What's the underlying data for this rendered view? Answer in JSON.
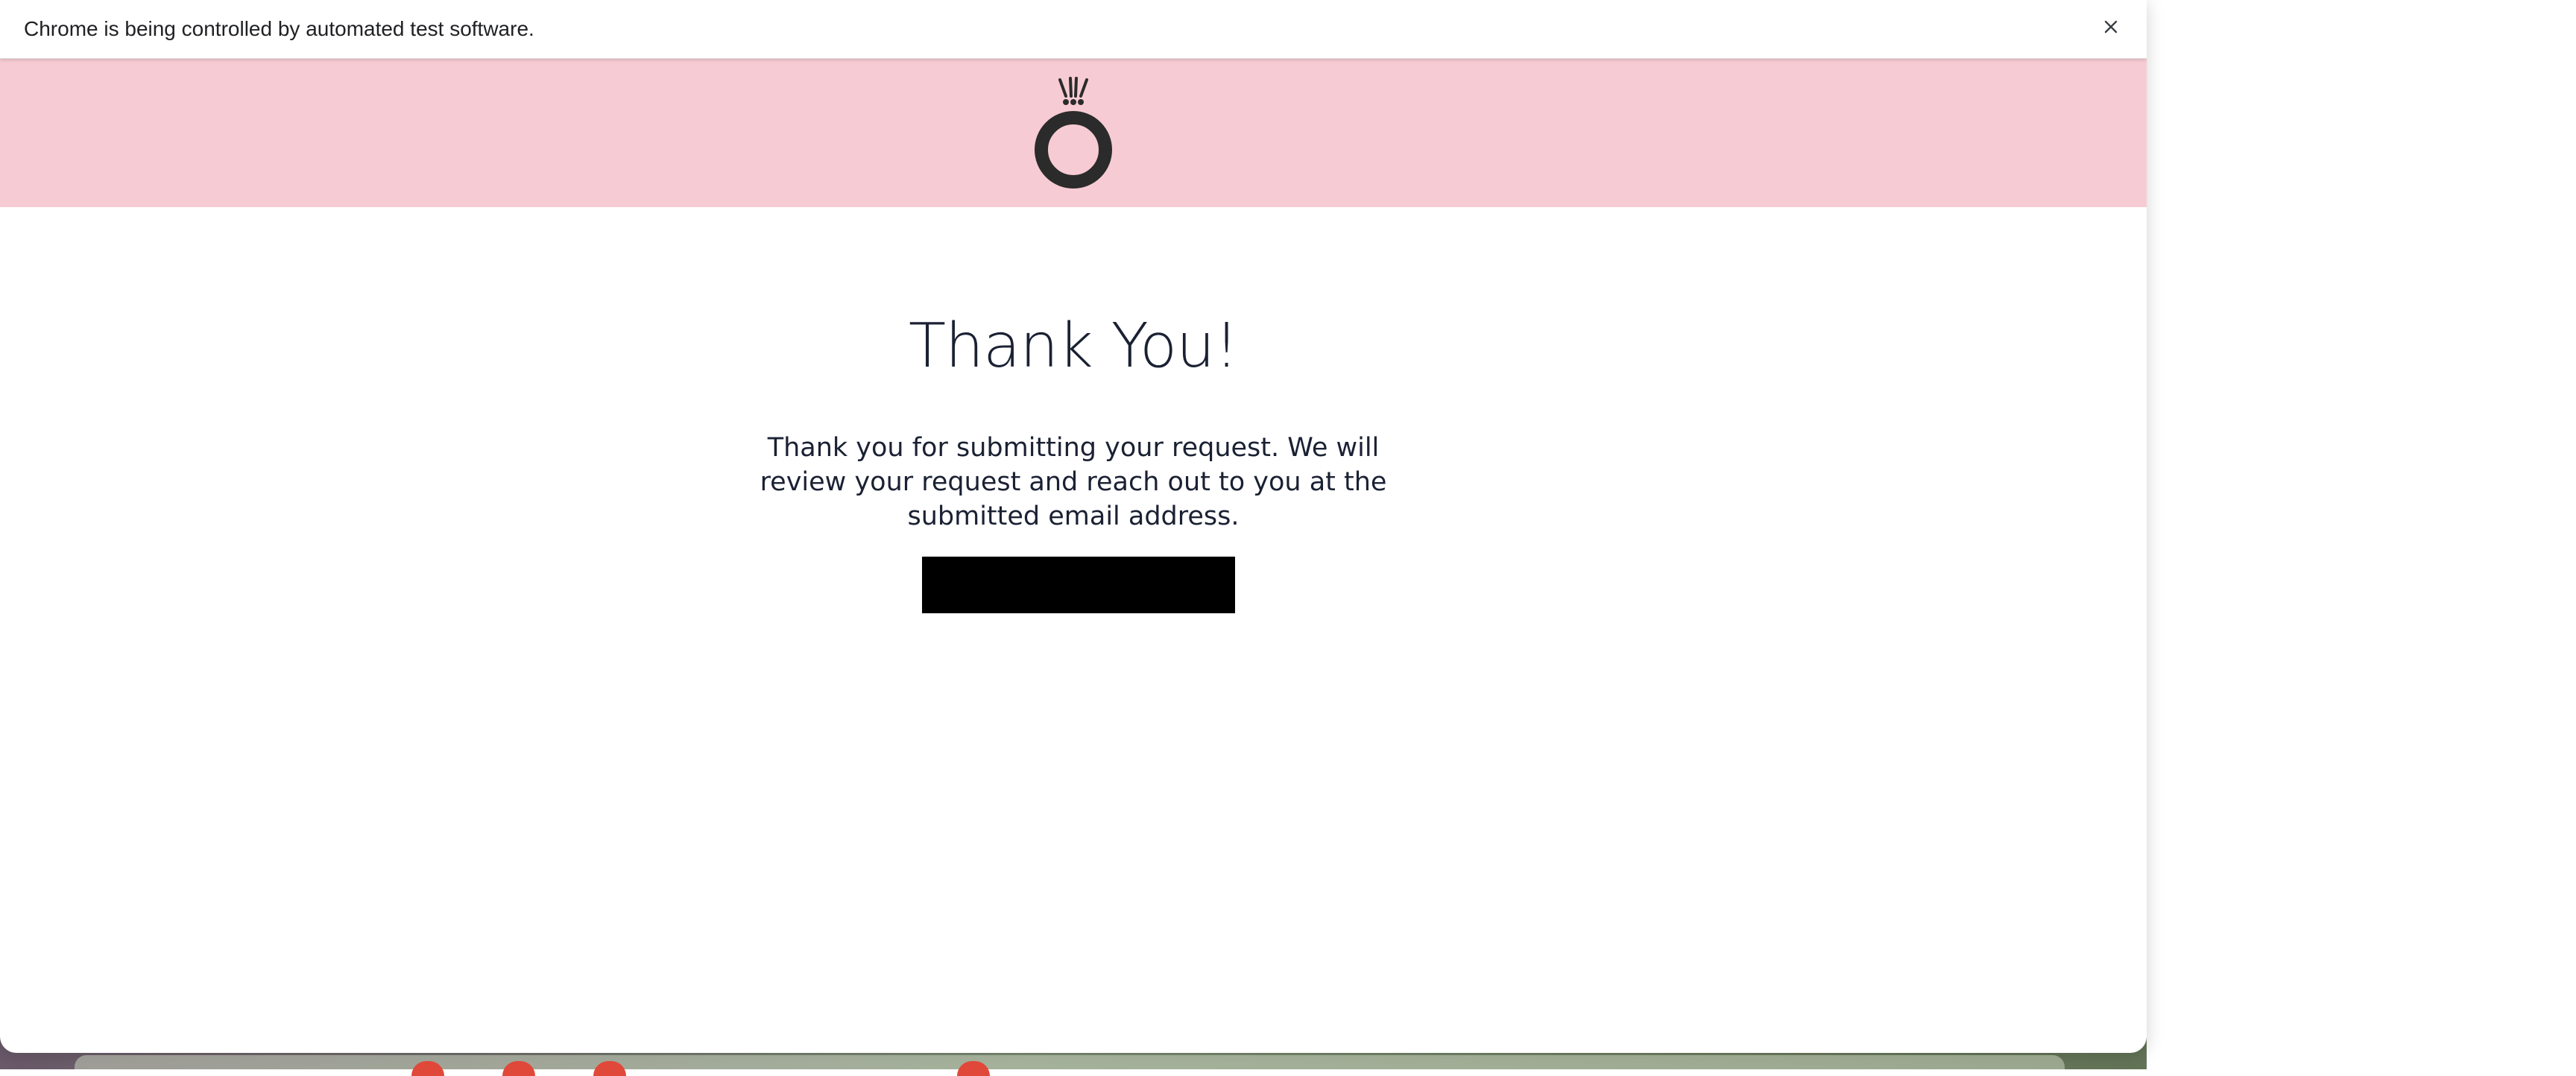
{
  "infobar": {
    "message": "Chrome is being controlled by automated test software.",
    "close_icon": "close-icon"
  },
  "header": {
    "logo_icon": "crown-ring-logo-icon",
    "background_color": "#f7cbd4"
  },
  "main": {
    "title": "Thank You!",
    "message": "Thank you for submitting your request. We will review your request and reach out to you at the submitted email address.",
    "button_label": ""
  },
  "colors": {
    "text": "#1a2133",
    "button": "#000000"
  }
}
